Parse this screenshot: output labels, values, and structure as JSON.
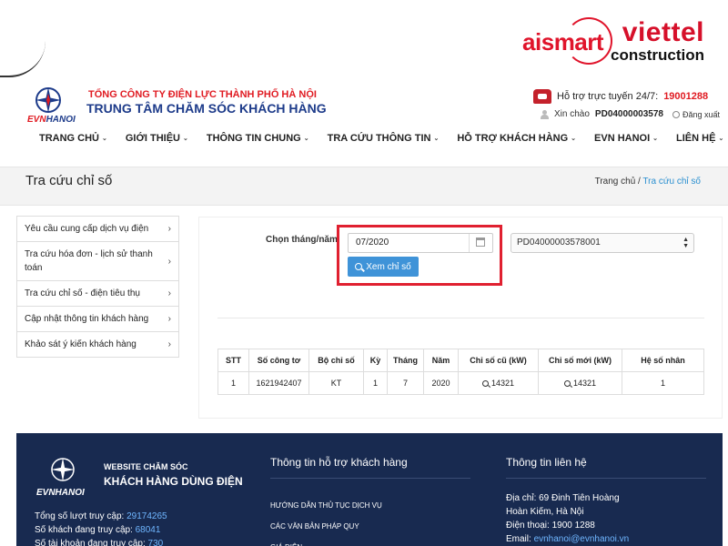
{
  "watermark": {
    "ai_brand": "aismart",
    "viettel": "viettel",
    "construction": "construction"
  },
  "header": {
    "logo_text_evn": "EVN",
    "logo_text_hanoi": "HANOI",
    "company": "TỔNG CÔNG TY ĐIỆN LỰC THÀNH PHỐ HÀ NỘI",
    "center": "TRUNG TÂM CHĂM SÓC KHÁCH HÀNG",
    "hotline_label": "Hỗ trợ trực tuyến 24/7:",
    "hotline_number": "19001288",
    "greeting": "Xin chào",
    "account": "PD04000003578",
    "logout": "Đăng xuất"
  },
  "nav": {
    "items": [
      {
        "label": "TRANG CHỦ"
      },
      {
        "label": "GIỚI THIỆU"
      },
      {
        "label": "THÔNG TIN CHUNG"
      },
      {
        "label": "TRA CỨU THÔNG TIN"
      },
      {
        "label": "HỖ TRỢ KHÁCH HÀNG"
      },
      {
        "label": "EVN HANOI"
      },
      {
        "label": "LIÊN HỆ"
      }
    ]
  },
  "titlebar": {
    "title": "Tra cứu chỉ số",
    "crumb_home": "Trang chủ",
    "crumb_sep": " / ",
    "crumb_current": "Tra cứu chỉ số"
  },
  "sidebar": {
    "items": [
      {
        "label": "Yêu cầu cung cấp dịch vụ điện"
      },
      {
        "label": "Tra cứu hóa đơn - lịch sử thanh toán"
      },
      {
        "label": "Tra cứu chỉ số - điện tiêu thụ"
      },
      {
        "label": "Cập nhật thông tin khách hàng"
      },
      {
        "label": "Khảo sát ý kiến khách hàng"
      }
    ]
  },
  "form": {
    "month_label": "Chọn tháng/năm",
    "month_value": "07/2020",
    "view_button": "Xem chỉ số",
    "account_select": "PD04000003578001"
  },
  "table": {
    "headers": [
      "STT",
      "Số công tơ",
      "Bộ chỉ số",
      "Kỳ",
      "Tháng",
      "Năm",
      "Chỉ số cũ (kW)",
      "Chỉ số mới (kW)",
      "Hệ số nhân"
    ],
    "rows": [
      [
        "1",
        "1621942407",
        "KT",
        "1",
        "7",
        "2020",
        "14321",
        "14321",
        "1"
      ]
    ]
  },
  "footer": {
    "evn": "EVNHANOI",
    "site_line1": "WEBSITE CHĂM SÓC",
    "site_line2": "KHÁCH HÀNG DÙNG ĐIỆN",
    "stats": [
      {
        "label": "Tổng số lượt truy cập: ",
        "value": "29174265"
      },
      {
        "label": "Số khách đang truy cập: ",
        "value": "68041"
      },
      {
        "label": "Số tài khoản đang truy cập: ",
        "value": "730"
      }
    ],
    "support_title": "Thông tin hỗ trợ khách hàng",
    "support_links": [
      "HƯỚNG DẪN THỦ TỤC DỊCH VỤ",
      "CÁC VĂN BẢN PHÁP QUY",
      "GIÁ ĐIỆN"
    ],
    "contact_title": "Thông tin liên hệ",
    "contact_address1": "Địa chỉ: 69 Đinh Tiên Hoàng",
    "contact_address2": "Hoàn Kiếm, Hà Nội",
    "contact_phone": "Điện thoại: 1900 1288",
    "contact_email_label": "Email: ",
    "contact_email": "evnhanoi@evnhanoi.vn"
  },
  "colors": {
    "brand_red": "#e01b22",
    "brand_blue": "#1d3b8a",
    "button_blue": "#3f93d8",
    "highlight_red": "#e02030",
    "footer_bg": "#182a50"
  }
}
